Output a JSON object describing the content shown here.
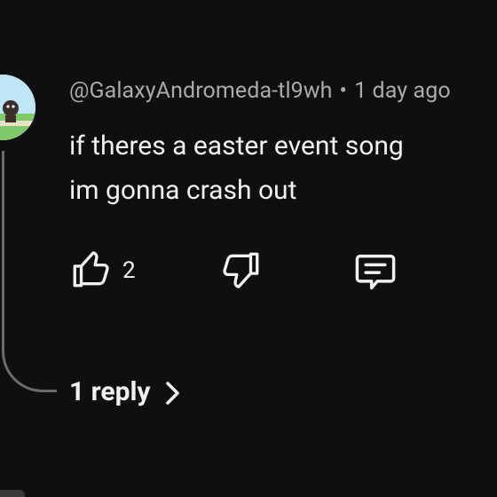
{
  "comment": {
    "author": "@GalaxyAndromeda-tl9wh",
    "separator": "•",
    "time": "1 day ago",
    "lines": [
      "if theres a easter event song",
      "im gonna crash out"
    ],
    "likes": "2"
  },
  "replies": {
    "label": "1 reply"
  },
  "icons": {
    "like": "thumbs-up-icon",
    "dislike": "thumbs-down-icon",
    "reply": "comment-icon",
    "expand": "chevron-right-icon"
  },
  "colors": {
    "background": "#0f0f0f",
    "text": "#f1f1f1",
    "meta": "#aaaaaa",
    "thread_line": "#6b6b6b"
  }
}
